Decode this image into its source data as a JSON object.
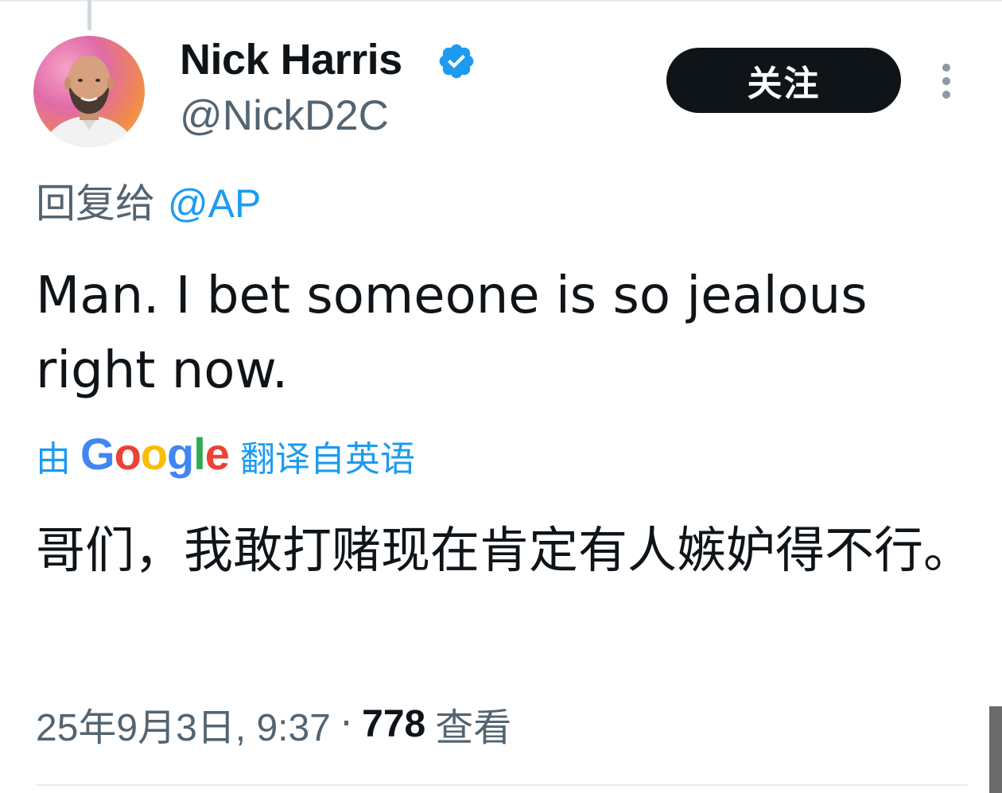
{
  "author": {
    "display_name": "Nick Harris",
    "handle": "@NickD2C",
    "verified": true,
    "verified_color": "#1d9bf0"
  },
  "follow_button": {
    "label": "关注"
  },
  "more_menu": {
    "icon": "more-vertical-icon"
  },
  "reply": {
    "prefix": "回复给",
    "mention": "@AP"
  },
  "tweet": {
    "text": "Man. I bet someone is so jealous right now."
  },
  "translation": {
    "by": "由",
    "provider": "Google",
    "suffix": "翻译自英语",
    "text": "哥们，我敢打赌现在肯定有人嫉妒得不行。"
  },
  "meta": {
    "date": "25年9月3日, 9:37",
    "separator": "·",
    "views_count": "778",
    "views_label": "查看"
  },
  "colors": {
    "accent": "#1d9bf0",
    "text_primary": "#0f1419",
    "text_secondary": "#536471",
    "button_bg": "#0f1419"
  }
}
